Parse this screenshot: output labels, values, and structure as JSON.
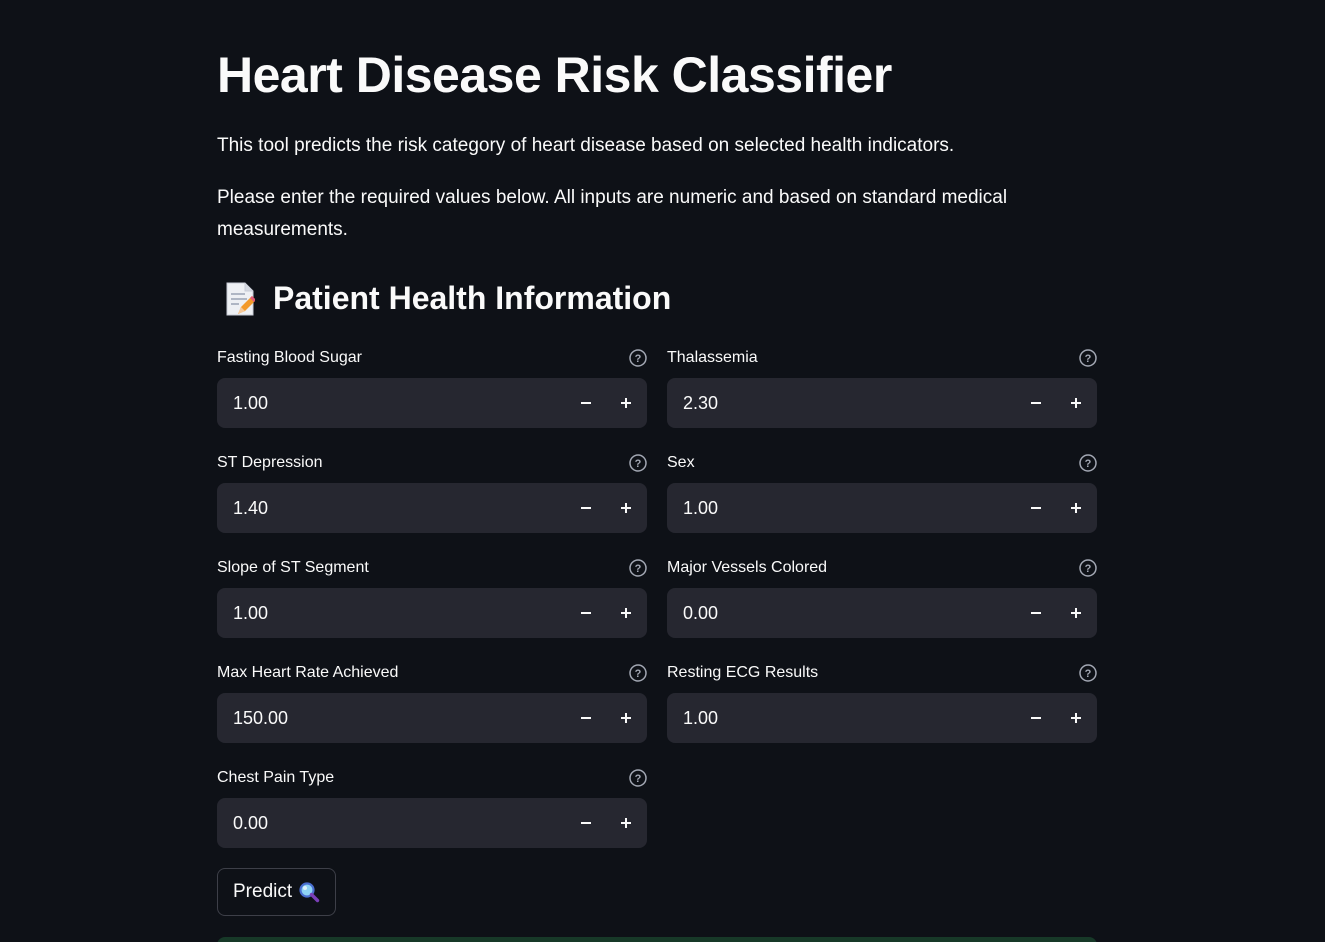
{
  "header": {
    "title": "Heart Disease Risk Classifier",
    "description_1": "This tool predicts the risk category of heart disease based on selected health indicators.",
    "description_2": "Please enter the required values below. All inputs are numeric and based on standard medical measurements."
  },
  "section": {
    "icon": "memo-icon",
    "heading": "Patient Health Information"
  },
  "fields": {
    "fasting_blood_sugar": {
      "label": "Fasting Blood Sugar",
      "value": "1.00"
    },
    "thalassemia": {
      "label": "Thalassemia",
      "value": "2.30"
    },
    "st_depression": {
      "label": "ST Depression",
      "value": "1.40"
    },
    "sex": {
      "label": "Sex",
      "value": "1.00"
    },
    "slope_st_segment": {
      "label": "Slope of ST Segment",
      "value": "1.00"
    },
    "major_vessels": {
      "label": "Major Vessels Colored",
      "value": "0.00"
    },
    "max_heart_rate": {
      "label": "Max Heart Rate Achieved",
      "value": "150.00"
    },
    "resting_ecg": {
      "label": "Resting ECG Results",
      "value": "1.00"
    },
    "chest_pain_type": {
      "label": "Chest Pain Type",
      "value": "0.00"
    }
  },
  "actions": {
    "predict_label": "Predict",
    "predict_icon": "magnifying-glass-icon"
  },
  "colors": {
    "background": "#0e1117",
    "input_background": "#262730",
    "text": "#fafafa",
    "result_strip": "#173928"
  }
}
